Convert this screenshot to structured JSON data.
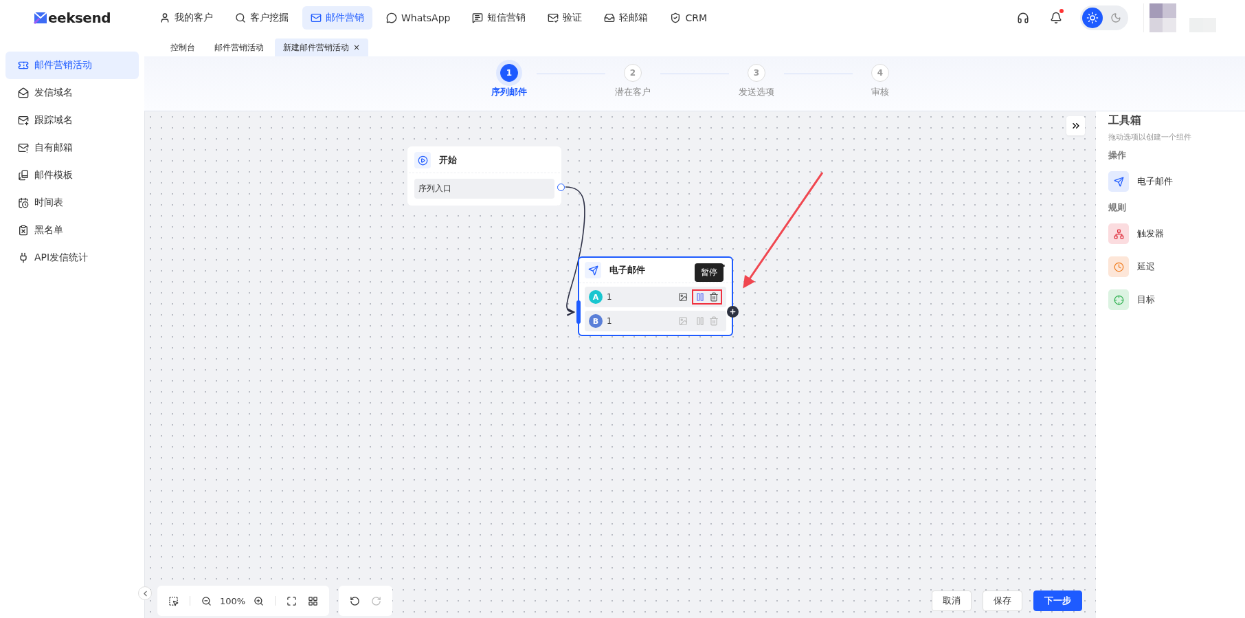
{
  "header": {
    "logo_text": "eeksend",
    "nav": [
      {
        "label": "我的客户",
        "selected": false
      },
      {
        "label": "客户挖掘",
        "selected": false
      },
      {
        "label": "邮件营销",
        "selected": true
      },
      {
        "label": "WhatsApp",
        "selected": false
      },
      {
        "label": "短信营销",
        "selected": false
      },
      {
        "label": "验证",
        "selected": false
      },
      {
        "label": "轻邮箱",
        "selected": false
      },
      {
        "label": "CRM",
        "selected": false
      }
    ],
    "dark_mode": false,
    "has_notification": true
  },
  "tabs": [
    {
      "label": "控制台",
      "selected": false
    },
    {
      "label": "邮件营销活动",
      "selected": false
    },
    {
      "label": "新建邮件营销活动",
      "selected": true,
      "close": "×"
    }
  ],
  "sidebar": {
    "items": [
      {
        "label": "邮件营销活动",
        "selected": true
      },
      {
        "label": "发信域名",
        "selected": false
      },
      {
        "label": "跟踪域名",
        "selected": false
      },
      {
        "label": "自有邮箱",
        "selected": false
      },
      {
        "label": "邮件模板",
        "selected": false
      },
      {
        "label": "时间表",
        "selected": false
      },
      {
        "label": "黑名单",
        "selected": false
      },
      {
        "label": "API发信统计",
        "selected": false
      }
    ]
  },
  "steps": [
    {
      "number": "1",
      "label": "序列邮件",
      "selected": true
    },
    {
      "number": "2",
      "label": "潜在客户",
      "selected": false
    },
    {
      "number": "3",
      "label": "发送选项",
      "selected": false
    },
    {
      "number": "4",
      "label": "审核",
      "selected": false
    }
  ],
  "canvas": {
    "start_node": {
      "title": "开始",
      "entry": "序列入口"
    },
    "email_node": {
      "title": "电子邮件",
      "selected": true,
      "tooltip": "暂停",
      "variants": [
        {
          "letter": "A",
          "value": "1",
          "color": "#19c6d0",
          "highlighted": true
        },
        {
          "letter": "B",
          "value": "1",
          "color": "#5a7fd8",
          "highlighted": false
        }
      ]
    },
    "zoom": "100%"
  },
  "toolbox": {
    "title": "工具箱",
    "subtitle": "拖动选项以创建一个组件",
    "sections": [
      {
        "title": "操作",
        "items": [
          {
            "label": "电子邮件",
            "kind": "email"
          }
        ]
      },
      {
        "title": "规则",
        "items": [
          {
            "label": "触发器",
            "kind": "trigger"
          },
          {
            "label": "延迟",
            "kind": "delay"
          },
          {
            "label": "目标",
            "kind": "goal"
          }
        ]
      }
    ]
  },
  "footer_buttons": [
    {
      "label": "取消",
      "kind": "default"
    },
    {
      "label": "保存",
      "kind": "default"
    },
    {
      "label": "下一步",
      "kind": "primary"
    }
  ]
}
